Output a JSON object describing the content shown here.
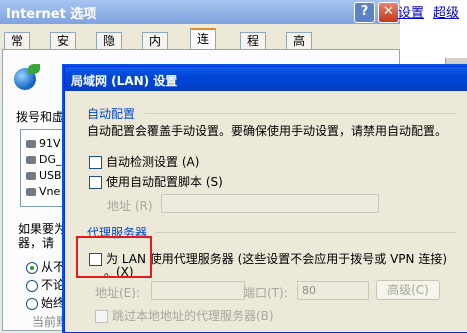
{
  "outer": {
    "title": "Internet 选项",
    "help_btn": "?",
    "close_btn": "✕",
    "tabs": [
      "常规",
      "安全",
      "隐私",
      "内容",
      "连接",
      "程序",
      "高级"
    ],
    "active_tab": "连接",
    "dialup_label": "拨号和虚",
    "connections": [
      "91V",
      "DG_",
      "USB",
      "Vne"
    ],
    "ifneed_line1": "如果要为",
    "ifneed_line2": "器，请",
    "radio_options": [
      "从不",
      "不论",
      "始终"
    ],
    "current_label": "当前默"
  },
  "strip": {
    "link1": "设置",
    "link2": "超级"
  },
  "lan": {
    "title": "局域网 (LAN) 设置",
    "auto_config": {
      "heading": "自动配置",
      "description": "自动配置会覆盖手动设置。要确保使用手动设置，请禁用自动配置。",
      "auto_detect": "自动检测设置 (A)",
      "use_script": "使用自动配置脚本 (S)",
      "address_label": "地址 (R)"
    },
    "proxy": {
      "heading": "代理服务器",
      "use_proxy_line1": "为 LAN 使用代理服务器 (这些设置不会应用于拨号或 VPN 连接)",
      "use_proxy_line2": "。(X)",
      "address_label": "地址(E):",
      "port_label": "端口(T):",
      "port_value": "80",
      "advanced_btn": "高级(C)",
      "bypass": "跳过本地地址的代理服务器(B)"
    }
  }
}
